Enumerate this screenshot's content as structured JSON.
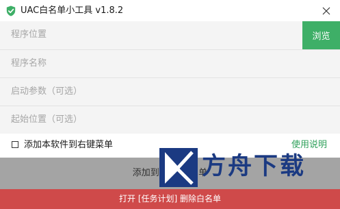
{
  "window": {
    "title": "UAC白名单小工具 v1.8.2",
    "icon": "shield-check-icon",
    "close_icon": "close-icon"
  },
  "fields": {
    "program_path": {
      "placeholder": "程序位置",
      "value": ""
    },
    "program_name": {
      "placeholder": "程序名称",
      "value": ""
    },
    "launch_args": {
      "placeholder": "启动参数（可选）",
      "value": ""
    },
    "start_dir": {
      "placeholder": "起始位置（可选）",
      "value": ""
    }
  },
  "buttons": {
    "browse": "浏览",
    "add_whitelist": "添加到 UAC白名单",
    "delete_whitelist": "打开 [任务计划] 删除白名单"
  },
  "options": {
    "context_menu": {
      "label": "添加本软件到右键菜单",
      "checked": false
    }
  },
  "links": {
    "usage_help": "使用说明"
  },
  "watermark": {
    "text": "方舟下载"
  },
  "colors": {
    "accent_green": "#3eaf67",
    "link_green": "#2ea05a",
    "danger_red": "#cf4a4a",
    "field_bg": "#f4f4f4",
    "add_button_bg": "#a4a4a4",
    "watermark_blue": "#1b3a82"
  }
}
